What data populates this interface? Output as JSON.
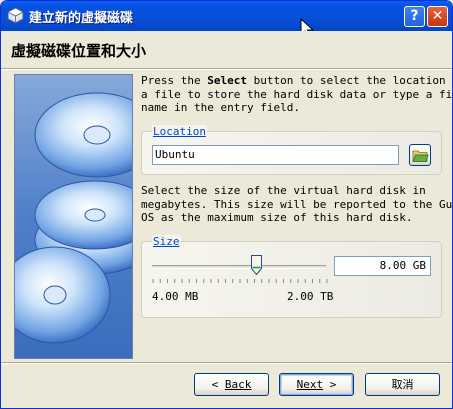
{
  "window": {
    "title": "建立新的虛擬磁碟"
  },
  "title_buttons": {
    "help": "?",
    "close": "✕"
  },
  "header": {
    "title": "虛擬磁碟位置和大小"
  },
  "location_help": [
    "Press the Select button to select the location of",
    "a file to store the hard disk data or type a file",
    "name in the entry field."
  ],
  "location": {
    "legend": "Location",
    "value": "Ubuntu",
    "select_icon": "folder-open-icon"
  },
  "size_help": [
    "Select the size of the virtual hard disk in",
    "megabytes. This size will be reported to the Guest",
    "OS as the maximum size of this hard disk."
  ],
  "size": {
    "legend": "Size",
    "value": "8.00 GB",
    "min_label": "4.00 MB",
    "max_label": "2.00 TB",
    "slider_fraction": 0.6
  },
  "buttons": {
    "back": "Back",
    "next": "Next",
    "cancel": "取消"
  },
  "colors": {
    "title_bar": "#0a4fd6",
    "legend": "#0046d5",
    "face": "#ece9d8"
  }
}
